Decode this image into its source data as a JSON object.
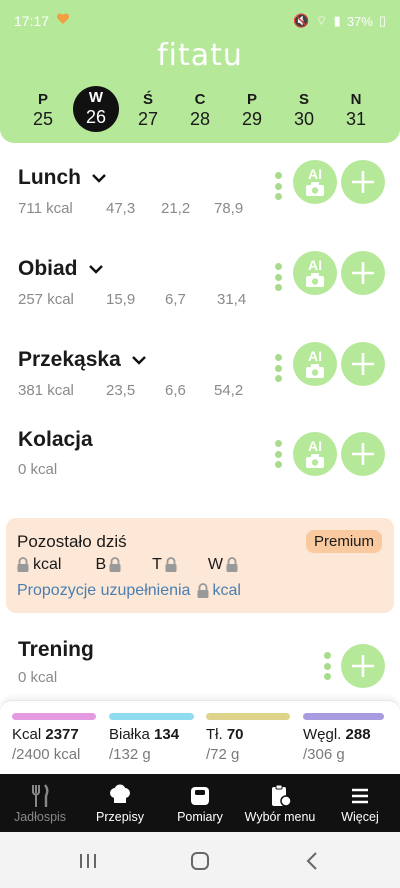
{
  "status": {
    "time": "17:17",
    "battery": "37%"
  },
  "app": {
    "logo": "fitatu"
  },
  "week": [
    {
      "letter": "P",
      "date": "25"
    },
    {
      "letter": "W",
      "date": "26",
      "selected": true
    },
    {
      "letter": "Ś",
      "date": "27"
    },
    {
      "letter": "C",
      "date": "28"
    },
    {
      "letter": "P",
      "date": "29"
    },
    {
      "letter": "S",
      "date": "30"
    },
    {
      "letter": "N",
      "date": "31"
    }
  ],
  "meals": [
    {
      "name": "Lunch",
      "kcal": "711 kcal",
      "protein": "47,3",
      "fat": "21,2",
      "carbs": "78,9"
    },
    {
      "name": "Obiad",
      "kcal": "257 kcal",
      "protein": "15,9",
      "fat": "6,7",
      "carbs": "31,4"
    },
    {
      "name": "Przekąska",
      "kcal": "381 kcal",
      "protein": "23,5",
      "fat": "6,6",
      "carbs": "54,2"
    },
    {
      "name": "Kolacja",
      "kcal": "0 kcal"
    }
  ],
  "ai_label": "AI",
  "remaining": {
    "title": "Pozostało dziś",
    "premium": "Premium",
    "kcal": "kcal",
    "b": "B",
    "t": "T",
    "w": "W",
    "suggestions": "Propozycje uzupełnienia",
    "suggestions_unit": "kcal"
  },
  "training": {
    "title": "Trening",
    "kcal": "0 kcal"
  },
  "summary": [
    {
      "label": "Kcal",
      "value": "2377",
      "target": "/2400 kcal",
      "color": "#e49ae0",
      "fill": 0.99
    },
    {
      "label": "Białka",
      "value": "134",
      "target": "/132 g",
      "color": "#8fdcf0",
      "fill": 1.0
    },
    {
      "label": "Tł.",
      "value": "70",
      "target": "/72 g",
      "color": "#ddd38a",
      "fill": 0.97
    },
    {
      "label": "Węgl.",
      "value": "288",
      "target": "/306 g",
      "color": "#a99be0",
      "fill": 0.94
    }
  ],
  "nav": [
    {
      "label": "Jadłospis",
      "icon": "fork-knife-icon"
    },
    {
      "label": "Przepisy",
      "icon": "chef-hat-icon"
    },
    {
      "label": "Pomiary",
      "icon": "scale-icon"
    },
    {
      "label": "Wybór menu",
      "icon": "clipboard-icon"
    },
    {
      "label": "Więcej",
      "icon": "menu-icon"
    }
  ]
}
